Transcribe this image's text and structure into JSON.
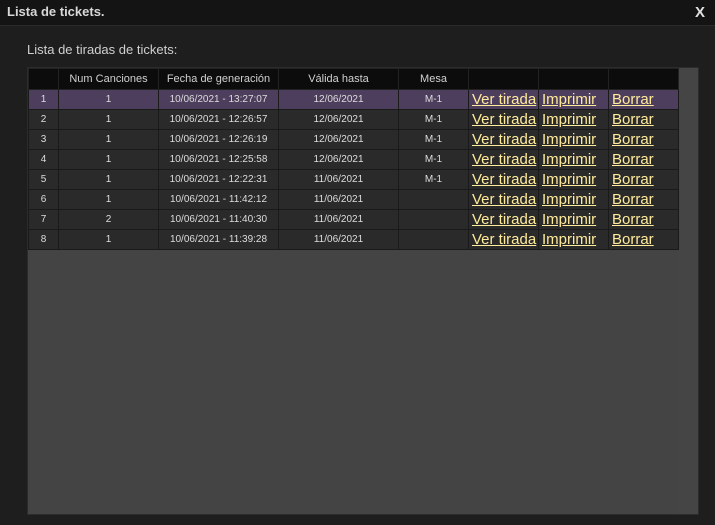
{
  "window": {
    "title": "Lista de tickets.",
    "close_label": "X"
  },
  "section": {
    "label": "Lista de tiradas de tickets:"
  },
  "table": {
    "headers": [
      "",
      "Num Canciones",
      "Fecha de generación",
      "Válida hasta",
      "Mesa",
      "",
      "",
      ""
    ],
    "rows": [
      {
        "n": "1",
        "canciones": "1",
        "fecha": "10/06/2021 - 13:27:07",
        "valida": "12/06/2021",
        "mesa": "M-1",
        "ver": "Ver tirada",
        "imprimir": "Imprimir",
        "borrar": "Borrar "
      },
      {
        "n": "2",
        "canciones": "1",
        "fecha": "10/06/2021 - 12:26:57",
        "valida": "12/06/2021",
        "mesa": "M-1",
        "ver": "Ver tirada",
        "imprimir": "Imprimir",
        "borrar": "Borrar "
      },
      {
        "n": "3",
        "canciones": "1",
        "fecha": "10/06/2021 - 12:26:19",
        "valida": "12/06/2021",
        "mesa": "M-1",
        "ver": "Ver tirada",
        "imprimir": "Imprimir",
        "borrar": "Borrar "
      },
      {
        "n": "4",
        "canciones": "1",
        "fecha": "10/06/2021 - 12:25:58",
        "valida": "12/06/2021",
        "mesa": "M-1",
        "ver": "Ver tirada",
        "imprimir": "Imprimir",
        "borrar": "Borrar "
      },
      {
        "n": "5",
        "canciones": "1",
        "fecha": "10/06/2021 - 12:22:31",
        "valida": "11/06/2021",
        "mesa": "M-1",
        "ver": "Ver tirada",
        "imprimir": "Imprimir",
        "borrar": "Borrar "
      },
      {
        "n": "6",
        "canciones": "1",
        "fecha": "10/06/2021 - 11:42:12",
        "valida": "11/06/2021",
        "mesa": "",
        "ver": "Ver tirada",
        "imprimir": "Imprimir",
        "borrar": "Borrar "
      },
      {
        "n": "7",
        "canciones": "2",
        "fecha": "10/06/2021 - 11:40:30",
        "valida": "11/06/2021",
        "mesa": "",
        "ver": "Ver tirada",
        "imprimir": "Imprimir",
        "borrar": "Borrar "
      },
      {
        "n": "8",
        "canciones": "1",
        "fecha": "10/06/2021 - 11:39:28",
        "valida": "11/06/2021",
        "mesa": "",
        "ver": "Ver tirada",
        "imprimir": "Imprimir",
        "borrar": "Borrar "
      }
    ],
    "selected_row": 1
  },
  "colors": {
    "link": "#ffeb9c",
    "selected_row": "#4e3e5e",
    "header_bg": "#0c0c0c",
    "panel_bg": "#444444"
  }
}
